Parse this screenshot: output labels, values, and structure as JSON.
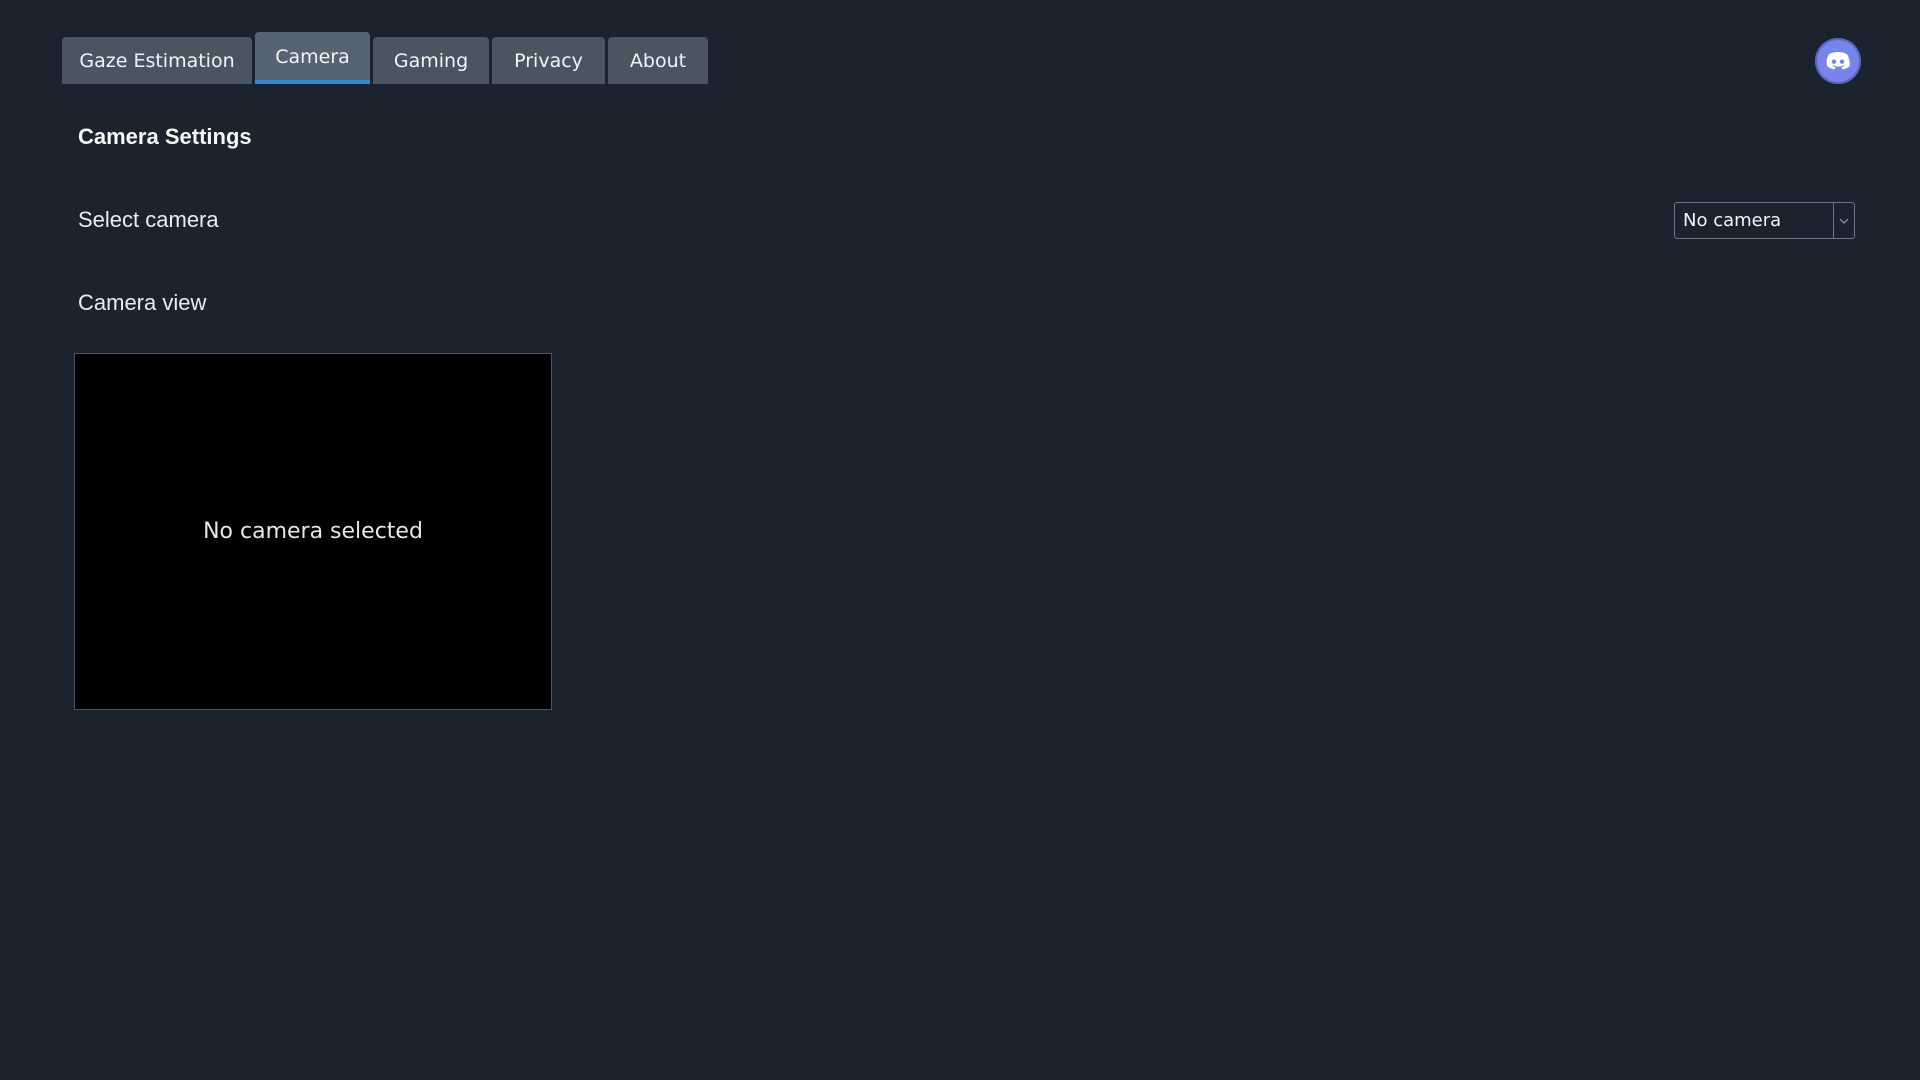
{
  "tabs": [
    {
      "label": "Gaze Estimation",
      "active": false
    },
    {
      "label": "Camera",
      "active": true
    },
    {
      "label": "Gaming",
      "active": false
    },
    {
      "label": "Privacy",
      "active": false
    },
    {
      "label": "About",
      "active": false
    }
  ],
  "header": {
    "discord_icon": "discord-icon"
  },
  "camera_settings": {
    "title": "Camera Settings",
    "select_label": "Select camera",
    "select_value": "No camera",
    "view_label": "Camera view",
    "view_message": "No camera selected"
  },
  "colors": {
    "background": "#1b232e",
    "tab_background": "#4a5563",
    "tab_active_background": "#566373",
    "tab_active_indicator": "#2b8bd7",
    "discord_button": "#7784ea",
    "camera_view_background": "#000000"
  }
}
